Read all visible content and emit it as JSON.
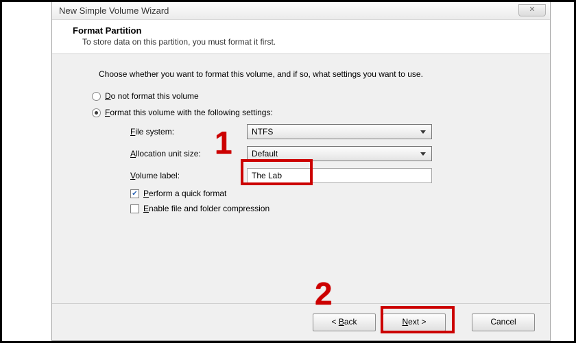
{
  "window": {
    "title": "New Simple Volume Wizard",
    "close_glyph": "✕"
  },
  "header": {
    "title": "Format Partition",
    "subtitle": "To store data on this partition, you must format it first."
  },
  "instruction": "Choose whether you want to format this volume, and if so, what settings you want to use.",
  "radios": {
    "no_format": "Do not format this volume",
    "do_format": "Format this volume with the following settings:"
  },
  "labels": {
    "file_system": "File system:",
    "allocation": "Allocation unit size:",
    "volume_label": "Volume label:"
  },
  "values": {
    "file_system": "NTFS",
    "allocation": "Default",
    "volume_label": "The Lab"
  },
  "checks": {
    "quick_format": "Perform a quick format",
    "compression": "Enable file and folder compression"
  },
  "buttons": {
    "back": "< Back",
    "next": "Next >",
    "cancel": "Cancel"
  },
  "annotations": {
    "one": "1",
    "two": "2"
  }
}
